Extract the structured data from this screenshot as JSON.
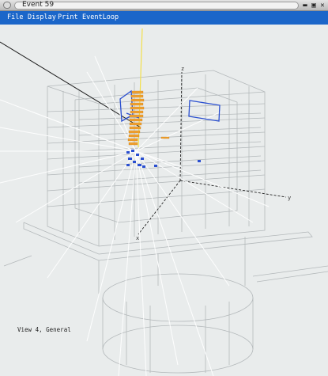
{
  "window": {
    "title": "Event 59"
  },
  "menu": {
    "items": [
      "File",
      "Display",
      "Print",
      "EventLoop"
    ]
  },
  "view": {
    "label": "View 4, General",
    "axes": {
      "x": "x",
      "y": "y",
      "z": "z"
    }
  },
  "colors": {
    "background": "#e9ecec",
    "menubar": "#1b66c9",
    "detector": "#aeb3b5",
    "tracks_white": "#ffffff",
    "tracks_orange": "#f0a030",
    "hits_blue": "#2a4fd0",
    "beam_yellow": "#f3e04a"
  }
}
